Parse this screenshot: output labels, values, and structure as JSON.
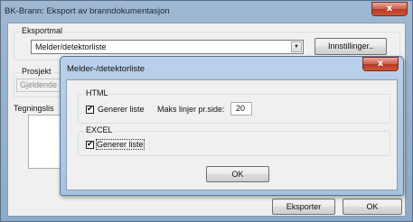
{
  "main_window": {
    "title": "BK-Brann: Eksport av branndokumentasjon",
    "close_glyph": "x",
    "export_template": {
      "legend": "Eksportmal",
      "selected": "Melder/detektorliste",
      "dropdown_arrow": "▼",
      "settings_button": "Innstillinger.."
    },
    "project": {
      "legend": "Prosjekt",
      "current_value": "Gjeldende"
    },
    "drawings_label": "Tegningslis",
    "footer": {
      "export_button": "Eksporter",
      "ok_button": "OK"
    }
  },
  "dialog": {
    "title": "Melder-/detektorliste",
    "close_glyph": "x",
    "html_group": {
      "legend": "HTML",
      "checkbox_label": "Generer liste",
      "checked": true,
      "max_lines_label": "Maks linjer pr.side:",
      "max_lines_value": "20"
    },
    "excel_group": {
      "legend": "EXCEL",
      "checkbox_label": "Generer liste",
      "checked": true
    },
    "ok_button": "OK",
    "check_glyph": "✔"
  },
  "colors": {
    "title_bar": "#9fb8d2",
    "dialog_frame": "#b9d1ea",
    "client_background": "#f0f0f0",
    "close_button": "#c9553e"
  }
}
